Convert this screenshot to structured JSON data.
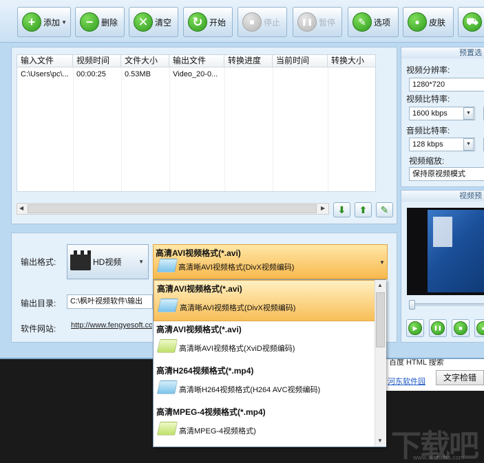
{
  "toolbar": {
    "buttons": [
      {
        "label": "添加",
        "icon": "plus-icon",
        "glyph": "+",
        "enabled": true,
        "has_dropdown": true
      },
      {
        "label": "删除",
        "icon": "minus-icon",
        "glyph": "−",
        "enabled": true
      },
      {
        "label": "清空",
        "icon": "clear-icon",
        "glyph": "✕",
        "enabled": true
      },
      {
        "label": "开始",
        "icon": "refresh-icon",
        "glyph": "↻",
        "enabled": true
      },
      {
        "label": "停止",
        "icon": "stop-icon",
        "glyph": "■",
        "enabled": false
      },
      {
        "label": "暂停",
        "icon": "pause-icon",
        "glyph": "❚❚",
        "enabled": false
      },
      {
        "label": "选项",
        "icon": "tools-icon",
        "glyph": "✎",
        "enabled": true
      },
      {
        "label": "皮肤",
        "icon": "apple-icon",
        "glyph": "●",
        "enabled": true
      },
      {
        "label": "",
        "icon": "cart-icon",
        "glyph": "⛟",
        "enabled": true
      }
    ]
  },
  "file_list": {
    "columns": [
      "输入文件",
      "视频时间",
      "文件大小",
      "输出文件",
      "转换进度",
      "当前时间",
      "转换大小"
    ],
    "rows": [
      [
        "C:\\Users\\pc\\...",
        "00:00:25",
        "0.53MB",
        "Video_20-0...",
        "",
        "",
        ""
      ]
    ],
    "action_buttons": [
      {
        "name": "move-down-button",
        "glyph": "⬇"
      },
      {
        "name": "move-up-button",
        "glyph": "⬆"
      },
      {
        "name": "edit-button",
        "glyph": "✎"
      }
    ]
  },
  "output": {
    "format_label": "输出格式:",
    "format_category": "HD视频",
    "selected_format_title": "高清AVI视频格式(*.avi)",
    "selected_format_sub": "高清晰AVI视频格式(DivX视频编码)",
    "dir_label": "输出目录:",
    "dir_value": "C:\\枫叶视频软件\\输出",
    "site_label": "软件网站:",
    "site_value": "http://www.fengyesoft.com"
  },
  "dropdown": {
    "items": [
      {
        "title": "高清AVI视频格式(*.avi)",
        "sub": "高清晰AVI视频格式(DivX视频编码)",
        "folder": "blue",
        "selected": true
      },
      {
        "title": "高清AVI视频格式(*.avi)",
        "sub": "高清晰AVI视频格式(XviD视频编码)",
        "folder": "lime",
        "selected": false
      },
      {
        "title": "高清H264视频格式(*.mp4)",
        "sub": "高清晰H264视频格式(H264 AVC视频编码)",
        "folder": "blue",
        "selected": false
      },
      {
        "title": "高清MPEG-4视频格式(*.mp4)",
        "sub": "高清MPEG-4视频格式)",
        "folder": "lime",
        "selected": false
      }
    ]
  },
  "presets": {
    "header": "预置选",
    "resolution_label": "视频分辨率:",
    "resolution_value": "1280*720",
    "video_bitrate_label": "视频比特率:",
    "video_bitrate_value": "1600 kbps",
    "audio_bitrate_label": "音频比特率:",
    "audio_bitrate_value": "128 kbps",
    "scale_label": "视频缩放:",
    "scale_value": "保持原视频模式"
  },
  "preview": {
    "header": "视频预",
    "seek_position": 0,
    "controls": [
      {
        "name": "play-button",
        "glyph": "▶"
      },
      {
        "name": "pause-button",
        "glyph": "❚❚"
      },
      {
        "name": "stop-button",
        "glyph": "■"
      },
      {
        "name": "extra-button",
        "glyph": "●"
      }
    ]
  },
  "background": {
    "text_a": "百度 HTML 搜索",
    "link_text": "河东软件园",
    "button_label": "文字检错",
    "watermark": "下载吧",
    "watermark_url": "www.xiazaiba.com"
  },
  "colors": {
    "accent_orange": "#f8b94d",
    "panel_blue": "#e4f0fa",
    "window_blue": "#bcd9f2",
    "icon_green": "#2f9c1f"
  }
}
